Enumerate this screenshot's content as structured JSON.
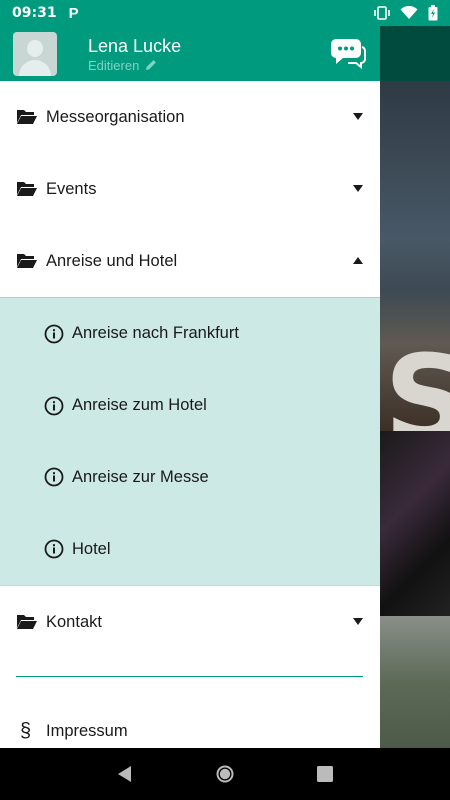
{
  "status_bar": {
    "time": "09:31",
    "app_indicator": "P"
  },
  "header": {
    "user_name": "Lena Lucke",
    "edit_label": "Editieren"
  },
  "menu": {
    "items": [
      {
        "label": "Messeorganisation",
        "expanded": false
      },
      {
        "label": "Events",
        "expanded": false
      },
      {
        "label": "Anreise und Hotel",
        "expanded": true
      },
      {
        "label": "Kontakt",
        "expanded": false
      }
    ],
    "submenu": [
      {
        "label": "Anreise nach Frankfurt"
      },
      {
        "label": "Anreise zum Hotel"
      },
      {
        "label": "Anreise zur Messe"
      },
      {
        "label": "Hotel"
      }
    ],
    "footer_item": {
      "label": "Impressum",
      "icon": "§"
    }
  },
  "colors": {
    "accent": "#009b7e",
    "submenu_bg": "#cde9e6",
    "edit_text": "#7fd4c3"
  }
}
